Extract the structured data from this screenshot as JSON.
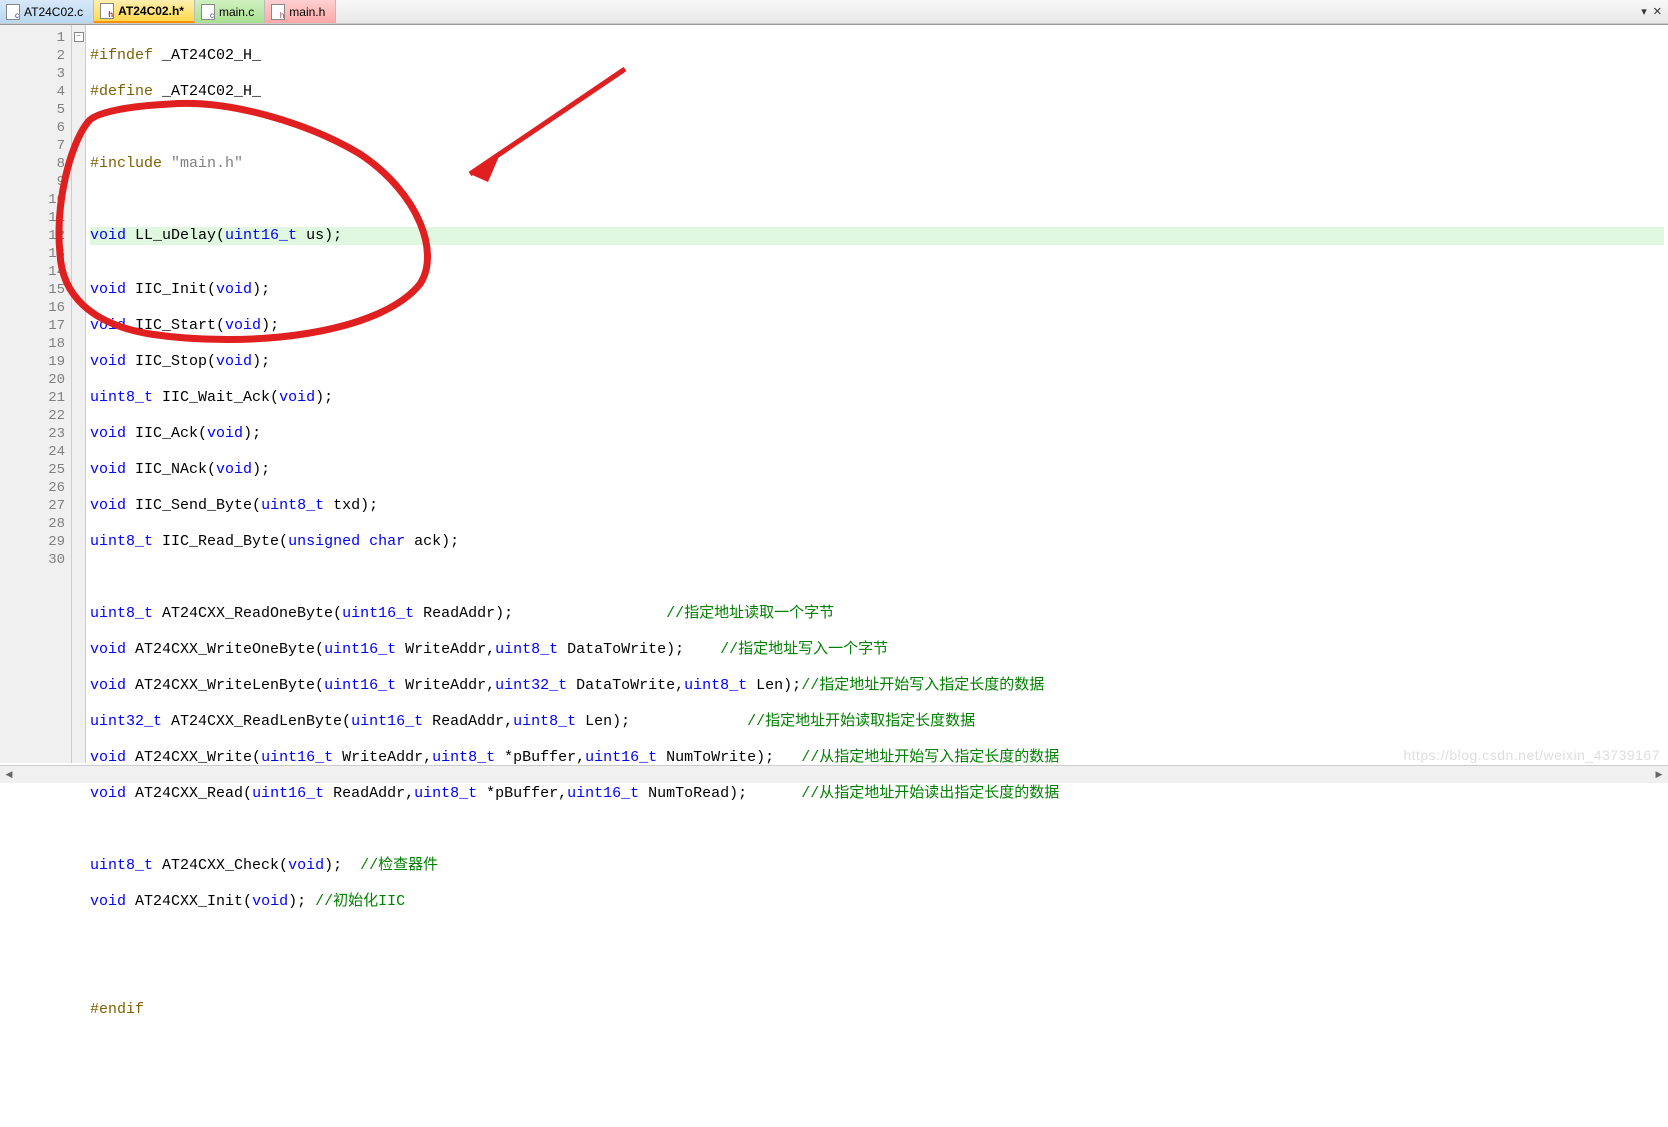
{
  "tabs": [
    {
      "label": "AT24C02.c",
      "kind": "c",
      "color": "blue"
    },
    {
      "label": "AT24C02.h*",
      "kind": "h",
      "color": "yellow"
    },
    {
      "label": "main.c",
      "kind": "c",
      "color": "green"
    },
    {
      "label": "main.h",
      "kind": "h",
      "color": "red"
    }
  ],
  "win": {
    "dropdown": "▾",
    "close": "✕"
  },
  "line_numbers": [
    "1",
    "2",
    "3",
    "4",
    "5",
    "6",
    "7",
    "8",
    "9",
    "10",
    "11",
    "12",
    "13",
    "14",
    "15",
    "16",
    "17",
    "18",
    "19",
    "20",
    "21",
    "22",
    "23",
    "24",
    "25",
    "26",
    "27",
    "28",
    "29",
    "30"
  ],
  "fold_symbol": "−",
  "code": {
    "l1": {
      "pre": "#ifndef",
      "ident": " _AT24C02_H_"
    },
    "l2": {
      "pre": "#define",
      "ident": " _AT24C02_H_"
    },
    "l4": {
      "pre": "#include ",
      "str": "\"main.h\""
    },
    "l6": {
      "t1": "void",
      "fn": " LL_uDelay",
      "p1": "(",
      "t2": "uint16_t",
      "p2": " us);"
    },
    "l8": {
      "t1": "void",
      "fn": " IIC_Init",
      "p1": "(",
      "t2": "void",
      "p2": ");"
    },
    "l9": {
      "t1": "void",
      "fn": " IIC_Start",
      "p1": "(",
      "t2": "void",
      "p2": ");"
    },
    "l10": {
      "t1": "void",
      "fn": " IIC_Stop",
      "p1": "(",
      "t2": "void",
      "p2": ");"
    },
    "l11": {
      "t1": "uint8_t",
      "fn": " IIC_Wait_Ack",
      "p1": "(",
      "t2": "void",
      "p2": ");"
    },
    "l12": {
      "t1": "void",
      "fn": " IIC_Ack",
      "p1": "(",
      "t2": "void",
      "p2": ");"
    },
    "l13": {
      "t1": "void",
      "fn": " IIC_NAck",
      "p1": "(",
      "t2": "void",
      "p2": ");"
    },
    "l14": {
      "t1": "void",
      "fn": " IIC_Send_Byte",
      "p1": "(",
      "t2": "uint8_t",
      "p2": " txd);"
    },
    "l15": {
      "t1": "uint8_t",
      "fn": " IIC_Read_Byte",
      "p1": "(",
      "t2": "unsigned",
      "sp": " ",
      "t3": "char",
      "p2": " ack);"
    },
    "l17": {
      "t1": "uint8_t",
      "fn": " AT24CXX_ReadOneByte",
      "p1": "(",
      "t2": "uint16_t",
      "p2": " ReadAddr);",
      "pad": "                 ",
      "cmt": "//指定地址读取一个字节"
    },
    "l18": {
      "t1": "void",
      "fn": " AT24CXX_WriteOneByte",
      "p1": "(",
      "t2": "uint16_t",
      "a1": " WriteAddr,",
      "t3": "uint8_t",
      "p2": " DataToWrite);",
      "pad": "    ",
      "cmt": "//指定地址写入一个字节"
    },
    "l19": {
      "t1": "void",
      "fn": " AT24CXX_WriteLenByte",
      "p1": "(",
      "t2": "uint16_t",
      "a1": " WriteAddr,",
      "t3": "uint32_t",
      "a2": " DataToWrite,",
      "t4": "uint8_t",
      "p2": " Len);",
      "cmt": "//指定地址开始写入指定长度的数据"
    },
    "l20": {
      "t1": "uint32_t",
      "fn": " AT24CXX_ReadLenByte",
      "p1": "(",
      "t2": "uint16_t",
      "a1": " ReadAddr,",
      "t3": "uint8_t",
      "p2": " Len);",
      "pad": "             ",
      "cmt": "//指定地址开始读取指定长度数据"
    },
    "l21": {
      "t1": "void",
      "fn": " AT24CXX_Write",
      "p1": "(",
      "t2": "uint16_t",
      "a1": " WriteAddr,",
      "t3": "uint8_t",
      "a2": " *pBuffer,",
      "t4": "uint16_t",
      "p2": " NumToWrite);",
      "pad": "   ",
      "cmt": "//从指定地址开始写入指定长度的数据"
    },
    "l22": {
      "t1": "void",
      "fn": " AT24CXX_Read",
      "p1": "(",
      "t2": "uint16_t",
      "a1": " ReadAddr,",
      "t3": "uint8_t",
      "a2": " *pBuffer,",
      "t4": "uint16_t",
      "p2": " NumToRead);",
      "pad": "      ",
      "cmt": "//从指定地址开始读出指定长度的数据"
    },
    "l24": {
      "t1": "uint8_t",
      "fn": " AT24CXX_Check",
      "p1": "(",
      "t2": "void",
      "p2": ");  ",
      "cmt": "//检查器件"
    },
    "l25": {
      "t1": "void",
      "fn": " AT24CXX_Init",
      "p1": "(",
      "t2": "void",
      "p2": "); ",
      "cmt": "//初始化IIC"
    },
    "l28": {
      "pre": "#endif"
    }
  },
  "watermark": "https://blog.csdn.net/weixin_43739167"
}
